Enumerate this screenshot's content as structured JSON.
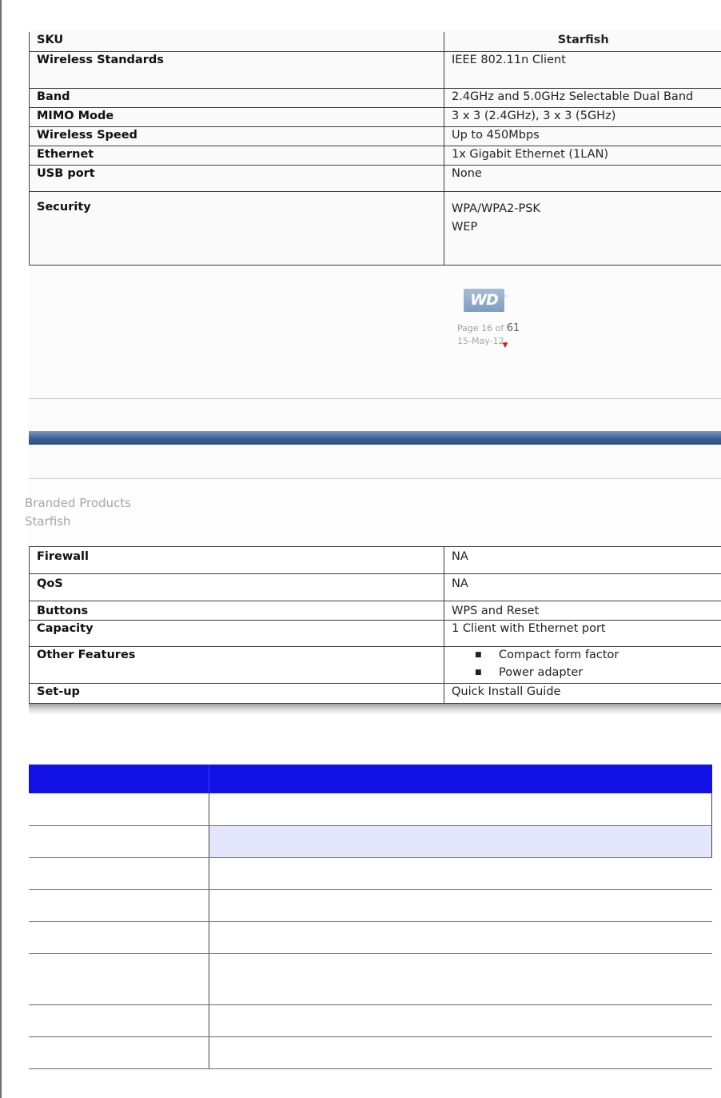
{
  "spec_top": {
    "header": {
      "label": "SKU",
      "value": "Starfish"
    },
    "rows": [
      {
        "label": "Wireless Standards",
        "value": "IEEE 802.11n Client"
      },
      {
        "label": "Band",
        "value": "2.4GHz and 5.0GHz Selectable Dual Band"
      },
      {
        "label": "MIMO Mode",
        "value": "3 x 3 (2.4GHz), 3 x 3 (5GHz)"
      },
      {
        "label": "Wireless Speed",
        "value": "Up to 450Mbps"
      },
      {
        "label": "Ethernet",
        "value": "1x Gigabit Ethernet (1LAN)"
      },
      {
        "label": "USB port",
        "value": "None"
      },
      {
        "label": "Security",
        "value_lines": [
          "WPA/WPA2-PSK",
          "WEP"
        ]
      }
    ]
  },
  "footer": {
    "logo": "WD",
    "logo_tm": "™",
    "page_prefix": "Page 16 of",
    "page_total": "61",
    "date": "15-May-12"
  },
  "branded": {
    "line1": "Branded Products",
    "line2": "Starfish"
  },
  "spec_bottom": {
    "rows": [
      {
        "label": "Firewall",
        "value": "NA"
      },
      {
        "label": "QoS",
        "value": "NA"
      },
      {
        "label": "Buttons",
        "value": "WPS and Reset"
      },
      {
        "label": "Capacity",
        "value": "1 Client with Ethernet port"
      },
      {
        "label": "Other Features",
        "features": [
          "Compact form factor",
          "Power adapter"
        ]
      },
      {
        "label": "Set-up",
        "value": "Quick Install Guide"
      }
    ]
  },
  "colors": {
    "grid_header": "#1212e8",
    "grid_shaded_row": "#e4e6fb",
    "band": "#3b5f92",
    "wd_logo": "#8ea9cb"
  }
}
